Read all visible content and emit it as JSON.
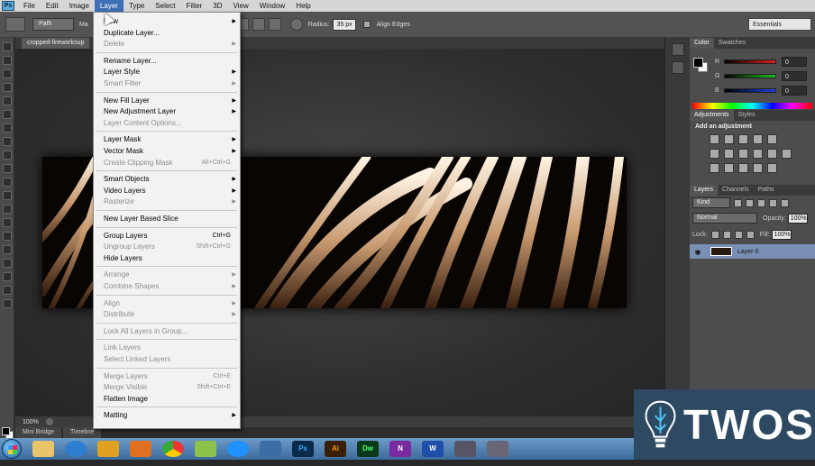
{
  "menubar": {
    "logo": "Ps",
    "items": [
      "File",
      "Edit",
      "Image",
      "Layer",
      "Type",
      "Select",
      "Filter",
      "3D",
      "View",
      "Window",
      "Help"
    ]
  },
  "options": {
    "path_mode": "Path",
    "make_partial": "Ma",
    "radius_label": "Radius:",
    "radius_value": "35 px",
    "align_edges": "Align Edges",
    "workspace": "Essentials"
  },
  "document": {
    "tab": "cropped-fireworksup",
    "zoom": "100%"
  },
  "bottom_tabs": [
    "Mini Bridge",
    "Timeline"
  ],
  "layer_menu": {
    "items": [
      {
        "label": "New",
        "shortcut": "",
        "arrow": true,
        "disabled": false
      },
      {
        "label": "Duplicate Layer...",
        "shortcut": "",
        "arrow": false,
        "disabled": false
      },
      {
        "label": "Delete",
        "shortcut": "",
        "arrow": true,
        "disabled": true
      },
      {
        "label": "Rename Layer...",
        "shortcut": "",
        "arrow": false,
        "disabled": false
      },
      {
        "label": "Layer Style",
        "shortcut": "",
        "arrow": true,
        "disabled": false
      },
      {
        "label": "Smart Filter",
        "shortcut": "",
        "arrow": true,
        "disabled": true
      },
      {
        "label": "New Fill Layer",
        "shortcut": "",
        "arrow": true,
        "disabled": false
      },
      {
        "label": "New Adjustment Layer",
        "shortcut": "",
        "arrow": true,
        "disabled": false
      },
      {
        "label": "Layer Content Options...",
        "shortcut": "",
        "arrow": false,
        "disabled": true
      },
      {
        "label": "Layer Mask",
        "shortcut": "",
        "arrow": true,
        "disabled": false
      },
      {
        "label": "Vector Mask",
        "shortcut": "",
        "arrow": true,
        "disabled": false
      },
      {
        "label": "Create Clipping Mask",
        "shortcut": "Alt+Ctrl+G",
        "arrow": false,
        "disabled": true
      },
      {
        "label": "Smart Objects",
        "shortcut": "",
        "arrow": true,
        "disabled": false
      },
      {
        "label": "Video Layers",
        "shortcut": "",
        "arrow": true,
        "disabled": false
      },
      {
        "label": "Rasterize",
        "shortcut": "",
        "arrow": true,
        "disabled": true
      },
      {
        "label": "New Layer Based Slice",
        "shortcut": "",
        "arrow": false,
        "disabled": false
      },
      {
        "label": "Group Layers",
        "shortcut": "Ctrl+G",
        "arrow": false,
        "disabled": false
      },
      {
        "label": "Ungroup Layers",
        "shortcut": "Shift+Ctrl+G",
        "arrow": false,
        "disabled": true
      },
      {
        "label": "Hide Layers",
        "shortcut": "",
        "arrow": false,
        "disabled": false
      },
      {
        "label": "Arrange",
        "shortcut": "",
        "arrow": true,
        "disabled": true
      },
      {
        "label": "Combine Shapes",
        "shortcut": "",
        "arrow": true,
        "disabled": true
      },
      {
        "label": "Align",
        "shortcut": "",
        "arrow": true,
        "disabled": true
      },
      {
        "label": "Distribute",
        "shortcut": "",
        "arrow": true,
        "disabled": true
      },
      {
        "label": "Lock All Layers in Group...",
        "shortcut": "",
        "arrow": false,
        "disabled": true
      },
      {
        "label": "Link Layers",
        "shortcut": "",
        "arrow": false,
        "disabled": true
      },
      {
        "label": "Select Linked Layers",
        "shortcut": "",
        "arrow": false,
        "disabled": true
      },
      {
        "label": "Merge Layers",
        "shortcut": "Ctrl+E",
        "arrow": false,
        "disabled": true
      },
      {
        "label": "Merge Visible",
        "shortcut": "Shift+Ctrl+E",
        "arrow": false,
        "disabled": true
      },
      {
        "label": "Flatten Image",
        "shortcut": "",
        "arrow": false,
        "disabled": false
      },
      {
        "label": "Matting",
        "shortcut": "",
        "arrow": true,
        "disabled": false
      }
    ]
  },
  "color_panel": {
    "tabs": [
      "Color",
      "Swatches"
    ],
    "channels": [
      {
        "label": "R",
        "value": "0",
        "color": "#e02020"
      },
      {
        "label": "G",
        "value": "0",
        "color": "#20c020"
      },
      {
        "label": "B",
        "value": "0",
        "color": "#2040e0"
      }
    ]
  },
  "adjustments_panel": {
    "tabs": [
      "Adjustments",
      "Styles"
    ],
    "title": "Add an adjustment"
  },
  "layers_panel": {
    "tabs": [
      "Layers",
      "Channels",
      "Paths"
    ],
    "kind": "Kind",
    "blend_mode": "Normal",
    "opacity_label": "Opacity:",
    "opacity": "100%",
    "lock_label": "Lock:",
    "fill_label": "Fill:",
    "fill": "100%",
    "layer_name": "Layer 0"
  },
  "taskbar": {
    "apps": [
      {
        "name": "Ps",
        "color": "#0b2a4a",
        "text": "#31a8ff"
      },
      {
        "name": "Ai",
        "color": "#3b1f05",
        "text": "#ff9a00"
      },
      {
        "name": "Dw",
        "color": "#0b3a1a",
        "text": "#4cff6a"
      },
      {
        "name": "N",
        "color": "#7a2aa0",
        "text": "#ffffff"
      },
      {
        "name": "W",
        "color": "#1f4fa8",
        "text": "#ffffff"
      }
    ]
  },
  "watermark": {
    "text": "TWOS"
  }
}
